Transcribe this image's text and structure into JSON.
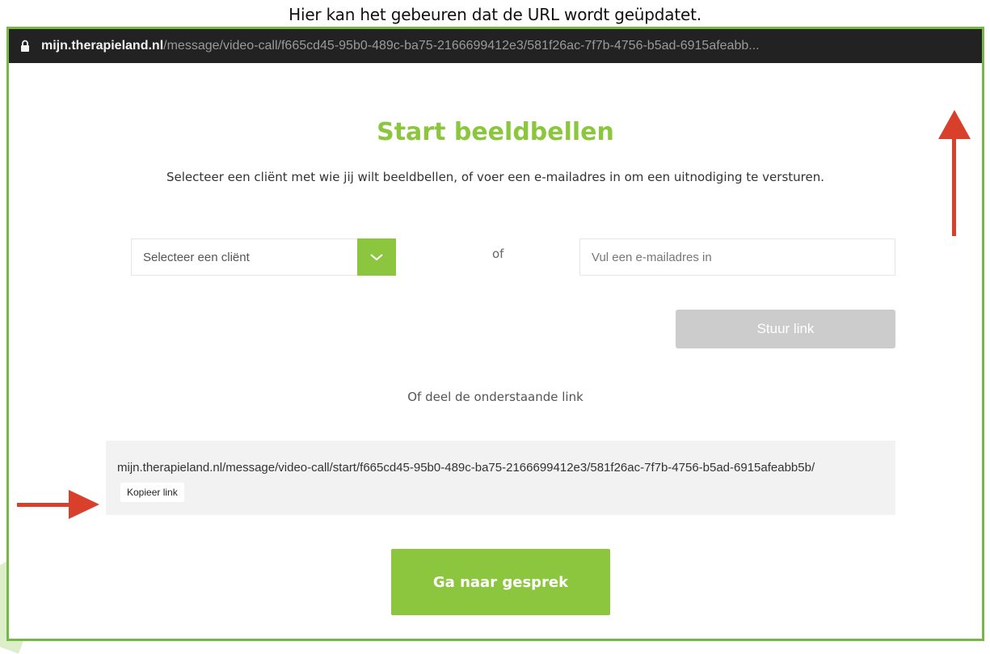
{
  "caption": "Hier kan het gebeuren dat de URL wordt geüpdatet.",
  "browser": {
    "url_host": "mijn.therapieland.nl",
    "url_path": "/message/video-call/f665cd45-95b0-489c-ba75-2166699412e3/581f26ac-7f7b-4756-b5ad-6915afeabb..."
  },
  "page": {
    "title": "Start beeldbellen",
    "subtitle": "Selecteer een cliënt met wie jij wilt beeldbellen, of voer een e-mailadres in om een uitnodiging te versturen.",
    "client_select": {
      "value": "Selecteer een cliënt"
    },
    "or_label": "of",
    "email": {
      "placeholder": "Vul een e-mailadres in",
      "value": ""
    },
    "send_button": "Stuur link",
    "share_label": "Of deel de onderstaande link",
    "share_link": "mijn.therapieland.nl/message/video-call/start/f665cd45-95b0-489c-ba75-2166699412e3/581f26ac-7f7b-4756-b5ad-6915afeabb5b/",
    "copy_button": "Kopieer link",
    "go_button": "Ga naar gesprek"
  },
  "colors": {
    "brand_green": "#8cc63f",
    "frame_green": "#76b843",
    "arrow_red": "#d9402b",
    "disabled_gray": "#cccccc",
    "urlbar_dark": "#222222"
  },
  "icons": [
    "lock-icon",
    "chevron-down-icon",
    "arrow-up-annotation",
    "arrow-right-annotation"
  ]
}
